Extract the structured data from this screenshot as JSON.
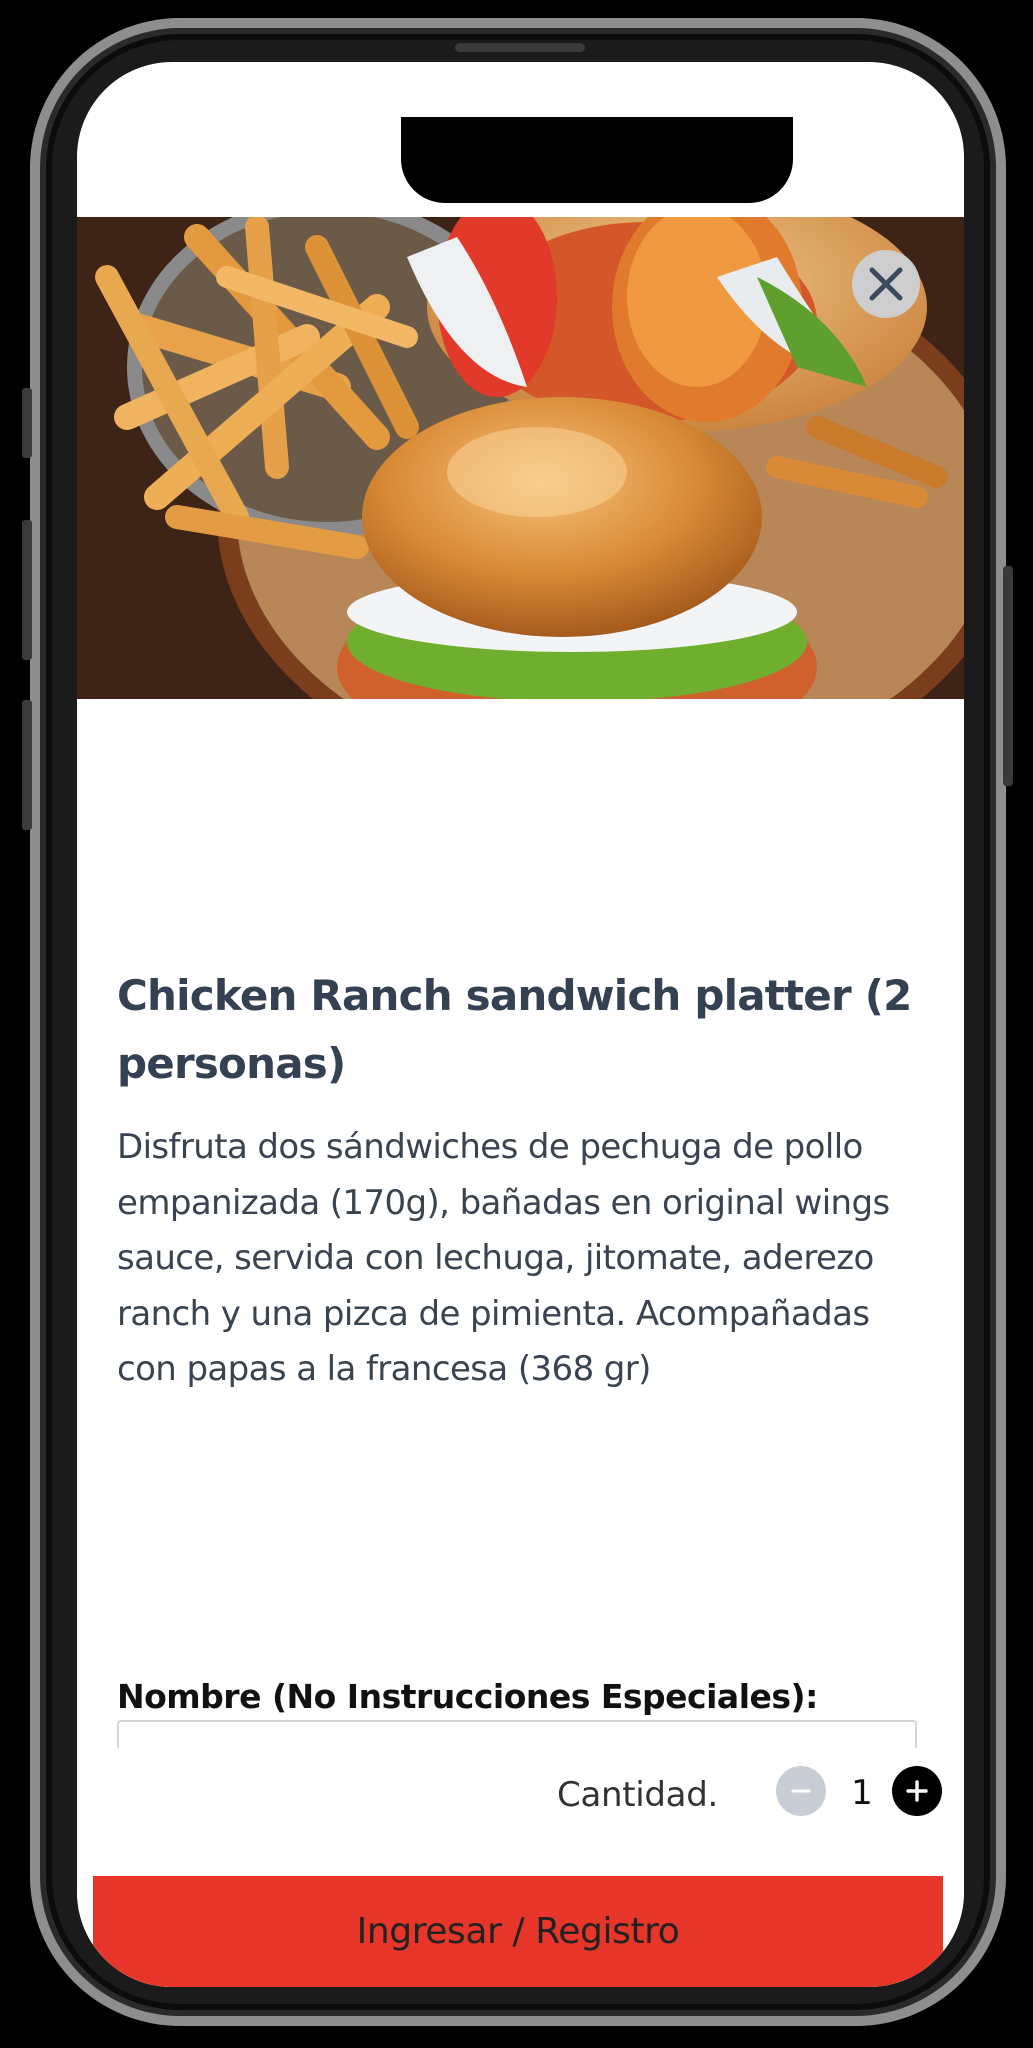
{
  "product": {
    "title": "Chicken Ranch sandwich platter (2 personas)",
    "description": "Disfruta dos sándwiches de pechuga de pollo empanizada (170g), bañadas en original wings sauce, servida con lechuga, jitomate, aderezo ranch y una pizca de pimienta. Acompañadas con papas a la francesa (368 gr)"
  },
  "form": {
    "name_label": "Nombre (No Instrucciones Especiales):",
    "name_value": ""
  },
  "quantity": {
    "label": "Cantidad.",
    "value": "1"
  },
  "cta": {
    "label": "Ingresar / Registro"
  },
  "colors": {
    "accent": "#e8352a",
    "title": "#344152"
  },
  "icons": {
    "close": "close-icon",
    "minus": "minus-icon",
    "plus": "plus-icon"
  }
}
